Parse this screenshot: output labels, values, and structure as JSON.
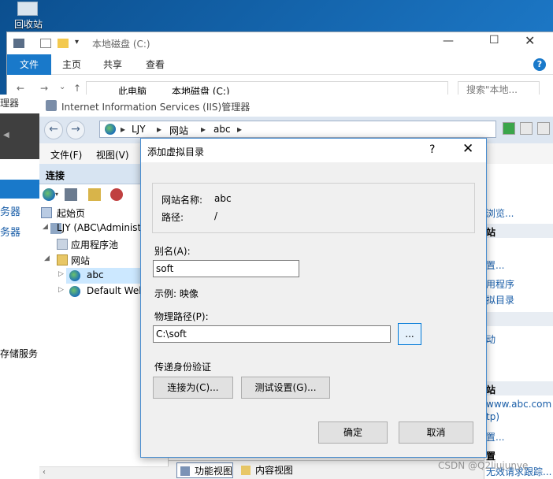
{
  "desktop": {
    "recycle_bin_label": "回收站"
  },
  "explorer": {
    "title": "本地磁盘 (C:)",
    "ribbon_tabs": [
      "文件",
      "主页",
      "共享",
      "查看"
    ],
    "help": "?",
    "address_path": [
      "此电脑",
      "本地磁盘 (C:)"
    ],
    "search_placeholder": "搜索\"本地...",
    "controls": {
      "minimize": "—",
      "maximize": "☐",
      "close": "✕"
    }
  },
  "left_stub": {
    "label": "理器",
    "items": [
      "务器",
      "务器",
      "存储服务"
    ]
  },
  "iis": {
    "title": "Internet Information Services (IIS)管理器",
    "breadcrumb": [
      "LJY",
      "网站",
      "abc"
    ],
    "menu": [
      "文件(F)",
      "视图(V)"
    ],
    "connections": {
      "header": "连接",
      "tree": [
        {
          "label": "起始页",
          "icon": "start-page-icon"
        },
        {
          "label": "LJY (ABC\\Administ",
          "icon": "server-icon"
        },
        {
          "label": "应用程序池",
          "icon": "app-pool-icon"
        },
        {
          "label": "网站",
          "icon": "sites-folder-icon"
        },
        {
          "label": "abc",
          "icon": "globe-icon"
        },
        {
          "label": "Default Web",
          "icon": "globe-icon"
        }
      ]
    },
    "footer_tabs": [
      "功能视图",
      "内容视图"
    ],
    "actions": {
      "links": [
        "浏览...",
        "站",
        "置...",
        "用程序",
        "拟目录",
        "动",
        "站",
        "www.abc.com on",
        "tp)",
        "置...",
        "置",
        "无效请求跟踪..."
      ]
    }
  },
  "dialog": {
    "title": "添加虚拟目录",
    "help": "?",
    "close": "✕",
    "site_name_label": "网站名称:",
    "site_name_value": "abc",
    "path_label": "路径:",
    "path_value": "/",
    "alias_label": "别名(A):",
    "alias_value": "soft",
    "example_text": "示例: 映像",
    "physical_path_label": "物理路径(P):",
    "physical_path_value": "C:\\soft",
    "browse_label": "...",
    "auth_label": "传递身份验证",
    "connect_as_label": "连接为(C)...",
    "test_settings_label": "测试设置(G)...",
    "ok_label": "确定",
    "cancel_label": "取消"
  },
  "watermark": "CSDN @Q2liujunye",
  "colors": {
    "accent": "#1979ca",
    "dialog_border": "#4a8ed0",
    "connections_header": "#d7e4f2"
  }
}
